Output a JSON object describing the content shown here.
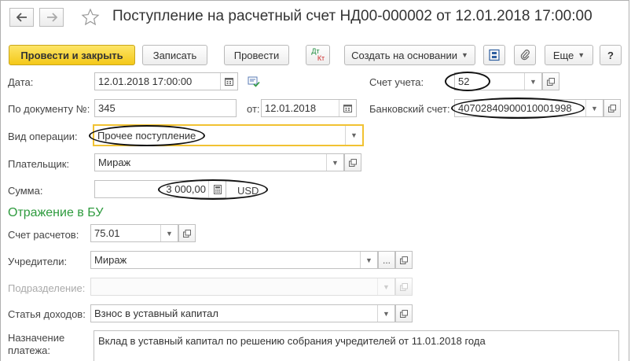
{
  "header": {
    "back_icon": "arrow-left-icon",
    "forward_icon": "arrow-right-icon",
    "favorite_icon": "star-icon",
    "title": "Поступление на расчетный счет НД00-000002 от 12.01.2018 17:00:00"
  },
  "toolbar": {
    "post_close": "Провести и закрыть",
    "save": "Записать",
    "post": "Провести",
    "dtkt_dt": "Дт",
    "dtkt_kt": "Кт",
    "create_basis": "Создать на основании",
    "more": "Еще",
    "help": "?"
  },
  "form": {
    "date_label": "Дата:",
    "date_value": "12.01.2018 17:00:00",
    "account_label": "Счет учета:",
    "account_value": "52",
    "doc_no_label": "По документу №:",
    "doc_no_value": "345",
    "from_label": "от:",
    "from_value": "12.01.2018",
    "bank_account_label": "Банковский счет:",
    "bank_account_value": "40702840900010001998",
    "operation_label": "Вид операции:",
    "operation_value": "Прочее поступление",
    "payer_label": "Плательщик:",
    "payer_value": "Мираж",
    "sum_label": "Сумма:",
    "sum_value": "3 000,00",
    "currency": "USD"
  },
  "accounting": {
    "section_title": "Отражение в БУ",
    "settlement_label": "Счет расчетов:",
    "settlement_value": "75.01",
    "founders_label": "Учредители:",
    "founders_value": "Мираж",
    "founders_select": "...",
    "division_label": "Подразделение:",
    "division_value": "",
    "income_label": "Статья доходов:",
    "income_value": "Взнос в уставный капитал",
    "purpose_label_1": "Назначение",
    "purpose_label_2": "платежа:",
    "purpose_value": "Вклад в уставный капитал по решению собрания учредителей от 11.01.2018 года"
  },
  "colors": {
    "primary_button": "#f4c818",
    "section_title": "#2e9b3e",
    "focus_border": "#f1c232"
  }
}
